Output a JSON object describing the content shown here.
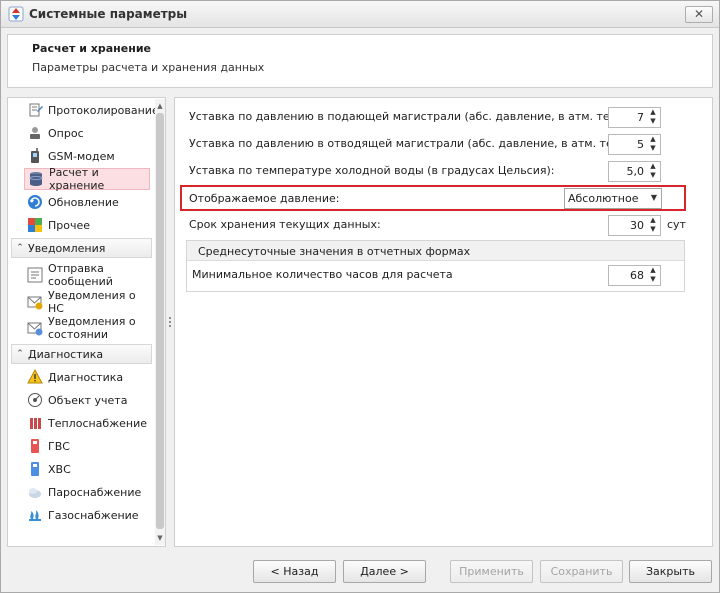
{
  "window": {
    "title": "Системные параметры",
    "close_label": "✕"
  },
  "header": {
    "title": "Расчет и хранение",
    "subtitle": "Параметры расчета и хранения данных"
  },
  "nav": {
    "items_top": [
      {
        "label": "Протоколирование",
        "icon": "log-icon"
      },
      {
        "label": "Опрос",
        "icon": "poll-icon"
      },
      {
        "label": "GSM-модем",
        "icon": "gsm-modem-icon"
      },
      {
        "label": "Расчет и хранение",
        "icon": "database-icon",
        "selected": true
      },
      {
        "label": "Обновление",
        "icon": "update-icon"
      },
      {
        "label": "Прочее",
        "icon": "other-icon"
      }
    ],
    "group_notifications": "Уведомления",
    "items_notifications": [
      {
        "label": "Отправка сообщений",
        "icon": "send-message-icon"
      },
      {
        "label": "Уведомления о НС",
        "icon": "alert-icon"
      },
      {
        "label": "Уведомления о состоянии системы",
        "icon": "system-status-icon"
      }
    ],
    "group_diagnostics": "Диагностика",
    "items_diagnostics": [
      {
        "label": "Диагностика",
        "icon": "warning-icon"
      },
      {
        "label": "Объект учета",
        "icon": "object-icon"
      },
      {
        "label": "Теплоснабжение",
        "icon": "heating-icon"
      },
      {
        "label": "ГВС",
        "icon": "hot-water-icon"
      },
      {
        "label": "ХВС",
        "icon": "cold-water-icon"
      },
      {
        "label": "Пароснабжение",
        "icon": "steam-icon"
      },
      {
        "label": "Газоснабжение",
        "icon": "gas-icon"
      }
    ]
  },
  "main": {
    "supply_pressure_label": "Уставка по давлению в подающей магистрали (абс. давление, в атм. техн.):",
    "supply_pressure_value": "7",
    "return_pressure_label": "Уставка по давлению в отводящей магистрали (абс. давление, в атм. техн.):",
    "return_pressure_value": "5",
    "cold_water_temp_label": "Уставка по температуре холодной воды (в градусах Цельсия):",
    "cold_water_temp_value": "5,0",
    "display_pressure_label": "Отображаемое давление:",
    "display_pressure_value": "Абсолютное",
    "storage_period_label": "Срок хранения текущих данных:",
    "storage_period_value": "30",
    "storage_period_unit": "сут",
    "daily_group_title": "Среднесуточные значения в отчетных формах",
    "min_hours_label": "Минимальное количество часов для расчета",
    "min_hours_value": "68"
  },
  "buttons": {
    "back": "< Назад",
    "next": "Далее >",
    "apply": "Применить",
    "save": "Сохранить",
    "close": "Закрыть"
  },
  "colors": {
    "selected_bg": "#fcdfe3",
    "highlight_border": "#d6262b"
  }
}
